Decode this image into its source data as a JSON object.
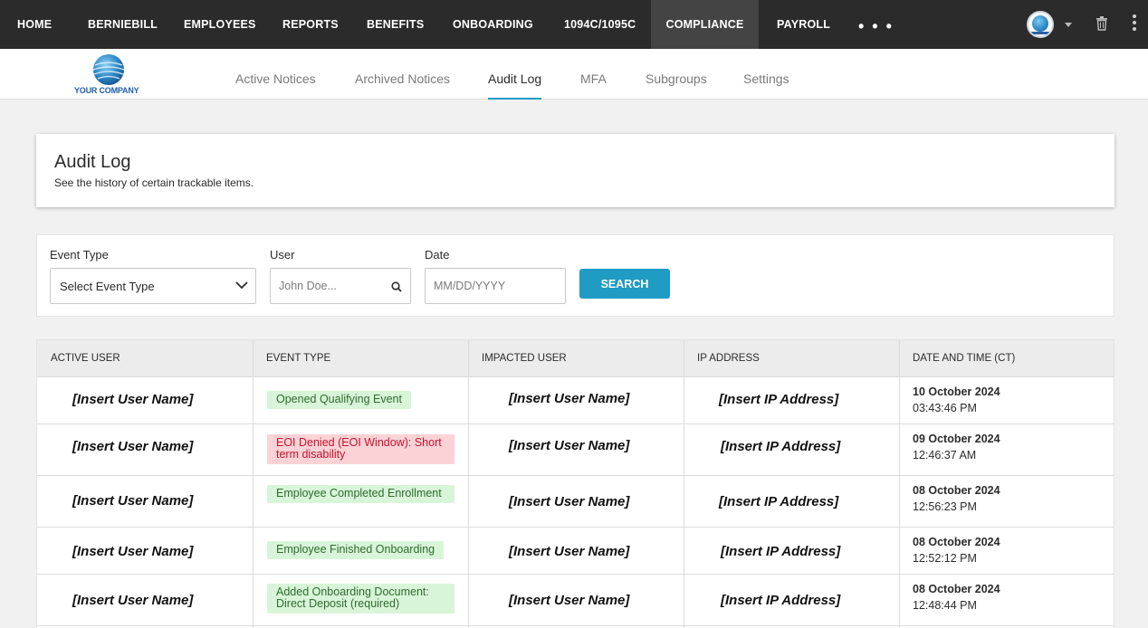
{
  "nav": {
    "items": [
      {
        "label": "HOME"
      },
      {
        "label": "BERNIEBILL"
      },
      {
        "label": "EMPLOYEES"
      },
      {
        "label": "REPORTS"
      },
      {
        "label": "BENEFITS"
      },
      {
        "label": "ONBOARDING"
      },
      {
        "label": "1094C/1095C"
      },
      {
        "label": "COMPLIANCE"
      },
      {
        "label": "PAYROLL"
      }
    ],
    "more": "• • •",
    "active": "COMPLIANCE"
  },
  "company": {
    "logo_text": "YOUR COMPANY"
  },
  "subnav": {
    "tabs": [
      {
        "label": "Active Notices"
      },
      {
        "label": "Archived Notices"
      },
      {
        "label": "Audit Log"
      },
      {
        "label": "MFA"
      },
      {
        "label": "Subgroups"
      },
      {
        "label": "Settings"
      }
    ],
    "active": "Audit Log"
  },
  "header": {
    "title": "Audit Log",
    "subtitle": "See the history of certain trackable items."
  },
  "filters": {
    "event_type_label": "Event Type",
    "event_type_value": "Select Event Type",
    "user_label": "User",
    "user_placeholder": "John Doe...",
    "date_label": "Date",
    "date_placeholder": "MM/DD/YYYY",
    "search_label": "SEARCH"
  },
  "table": {
    "headers": [
      "ACTIVE USER",
      "EVENT TYPE",
      "IMPACTED USER",
      "IP ADDRESS",
      "DATE AND TIME (CT)"
    ],
    "rows": [
      {
        "active_user": "[Insert User Name]",
        "event": "Opened Qualifying Event",
        "status": "green",
        "impacted_user": "[Insert User Name]",
        "ip": "[Insert IP Address]",
        "date": "10 October 2024",
        "time": "03:43:46 PM"
      },
      {
        "active_user": "[Insert User Name]",
        "event": "EOI Denied (EOI Window): Short term disability",
        "status": "red",
        "impacted_user": "[Insert User Name]",
        "ip": "[Insert IP Address]",
        "date": "09 October 2024",
        "time": "12:46:37 AM"
      },
      {
        "active_user": "[Insert User Name]",
        "event": "Employee Completed Enrollment",
        "status": "green",
        "impacted_user": "[Insert User Name]",
        "ip": "[Insert IP Address]",
        "date": "08 October 2024",
        "time": "12:56:23 PM"
      },
      {
        "active_user": "[Insert User Name]",
        "event": "Employee Finished Onboarding",
        "status": "green",
        "impacted_user": "[Insert User Name]",
        "ip": "[Insert IP Address]",
        "date": "08 October 2024",
        "time": "12:52:12 PM"
      },
      {
        "active_user": "[Insert User Name]",
        "event": "Added Onboarding Document: Direct Deposit (required)",
        "status": "green",
        "impacted_user": "[Insert User Name]",
        "ip": "[Insert IP Address]",
        "date": "08 October 2024",
        "time": "12:48:44 PM"
      }
    ]
  },
  "icons": {
    "avatar": "company-globe-icon",
    "caret": "caret-down-icon",
    "trash": "trash-icon",
    "kebab": "kebab-menu-icon",
    "search": "search-icon",
    "chevron": "chevron-down-icon"
  },
  "colors": {
    "nav_bg": "#2b2b2b",
    "nav_active_bg": "#444444",
    "accent": "#1f9bc4",
    "badge_green_bg": "#d9f5d9",
    "badge_red_bg": "#fbd3d6",
    "badge_red_text": "#c8102e"
  }
}
